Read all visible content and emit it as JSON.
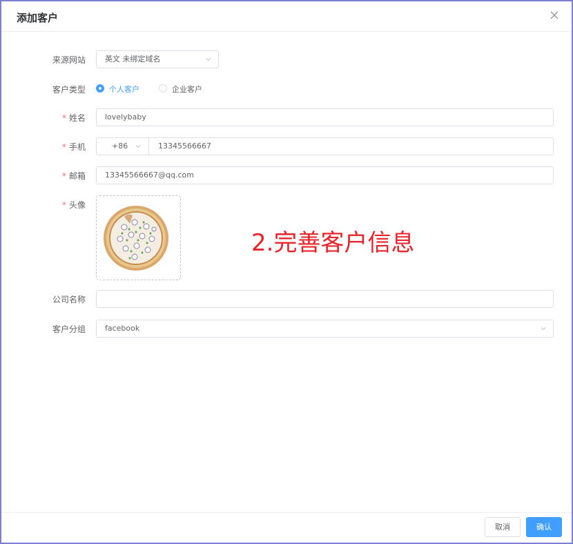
{
  "dialog": {
    "title": "添加客户",
    "close_icon": "close-icon"
  },
  "form": {
    "source_site": {
      "label": "来源网站",
      "value": "英文 未绑定域名"
    },
    "customer_type": {
      "label": "客户类型",
      "options": [
        {
          "label": "个人客户",
          "selected": true
        },
        {
          "label": "企业客户",
          "selected": false
        }
      ]
    },
    "name": {
      "required_mark": "*",
      "label": "姓名",
      "value": "lovelybaby"
    },
    "phone": {
      "required_mark": "*",
      "label": "手机",
      "country_code": "+86",
      "value": "13345566667"
    },
    "email": {
      "required_mark": "*",
      "label": "邮箱",
      "value": "13345566667@qq.com"
    },
    "avatar": {
      "required_mark": "*",
      "label": "头像",
      "image": "pizza-avatar"
    },
    "company": {
      "label": "公司名称",
      "value": ""
    },
    "group": {
      "label": "客户分组",
      "value": "facebook"
    }
  },
  "annotation": {
    "text": "2.完善客户信息",
    "color": "#e8232a"
  },
  "footer": {
    "cancel_label": "取消",
    "confirm_label": "确认"
  },
  "colors": {
    "primary": "#409eff",
    "required": "#f56c6c",
    "frame_border": "#7b7fd1"
  }
}
